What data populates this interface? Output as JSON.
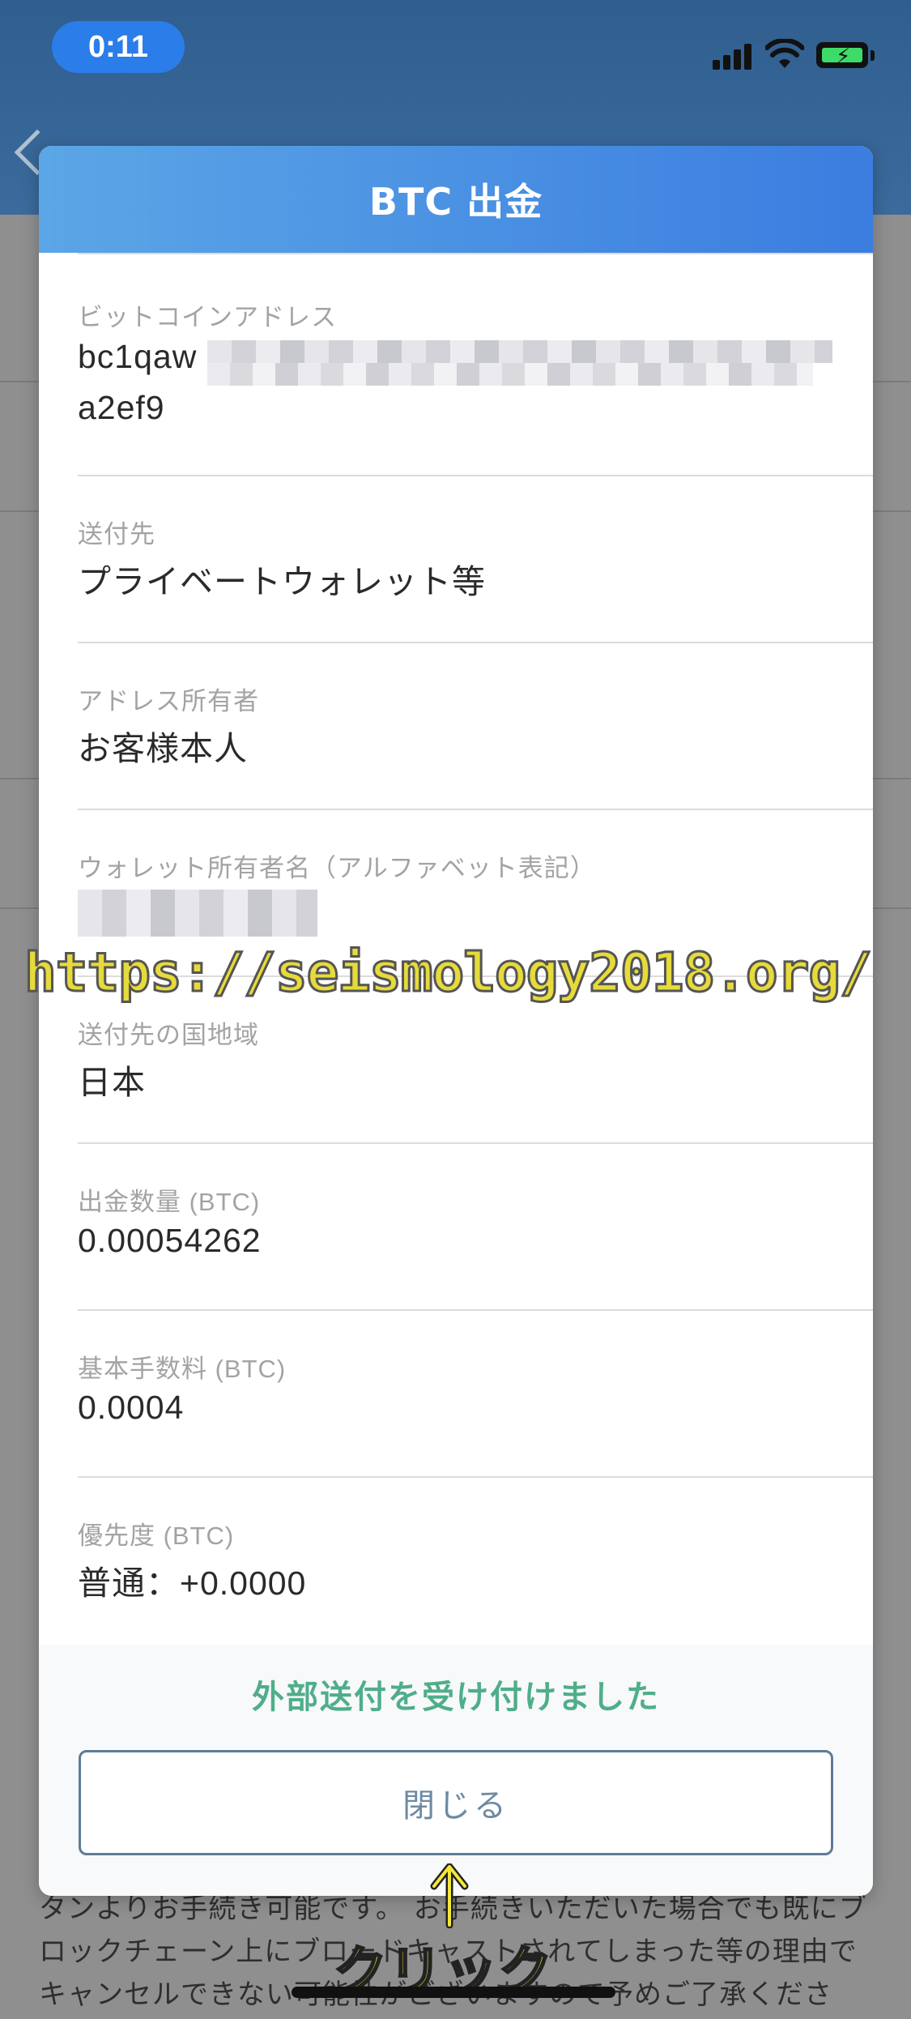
{
  "status_bar": {
    "time": "0:11"
  },
  "modal": {
    "title": "BTC 出金",
    "rows": [
      {
        "label": "ビットコインアドレス",
        "value_line1": "bc1qaw",
        "value_line2": "a2ef9"
      },
      {
        "label": "送付先",
        "value": "プライベートウォレット等"
      },
      {
        "label": "アドレス所有者",
        "value": "お客様本人"
      },
      {
        "label": "ウォレット所有者名（アルファベット表記）",
        "value": ""
      },
      {
        "label": "送付先の国地域",
        "value": "日本"
      },
      {
        "label": "出金数量 (BTC)",
        "value": "0.00054262"
      },
      {
        "label": "基本手数料 (BTC)",
        "value": "0.0004"
      },
      {
        "label": "優先度 (BTC)",
        "value": "普通：+0.0000"
      }
    ],
    "success_message": "外部送付を受け付けました",
    "close_label": "閉じる"
  },
  "background": {
    "notice_text": "タンよりお手続き可能です。 お手続きいただいた場合でも既にブロックチェーン上にブロードキャストされてしまった等の理由でキャンセルできない可能性がございますので予めご了承ください。"
  },
  "overlay": {
    "watermark": "https://seismology2018.org/",
    "click_label": "クリック"
  }
}
